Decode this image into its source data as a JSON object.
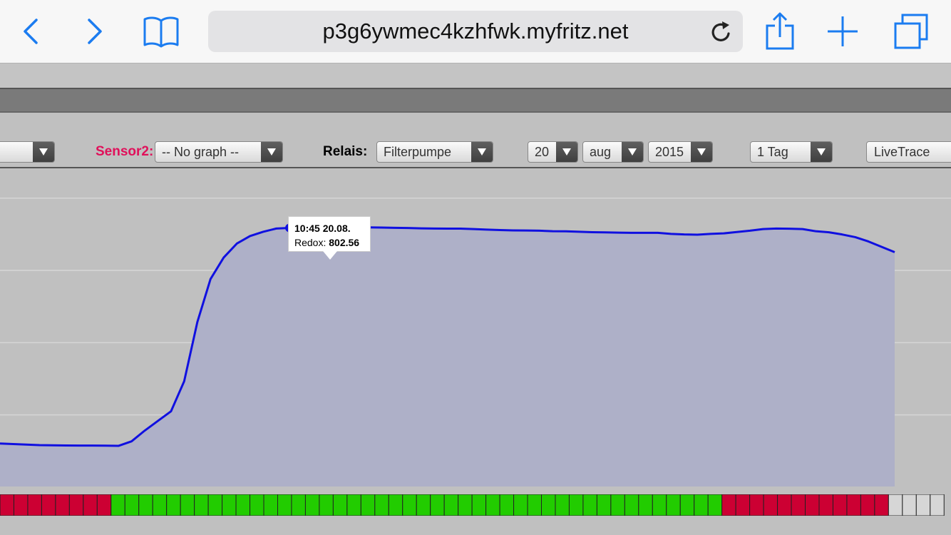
{
  "browser": {
    "url": "p3g6ywmec4kzhfwk.myfritz.net",
    "icons": [
      "back-icon",
      "forward-icon",
      "bookmarks-icon",
      "reload-icon",
      "share-icon",
      "new-tab-icon",
      "tabs-icon"
    ],
    "accent": "#1b7cf0"
  },
  "controls": {
    "sensor2_label": "Sensor2:",
    "sensor2_color": "#e0105a",
    "sensor2_value": "-- No graph --",
    "relais_label": "Relais:",
    "relais_value": "Filterpumpe",
    "day_value": "20",
    "month_value": "aug",
    "year_value": "2015",
    "range_value": "1 Tag",
    "livetrace_label": "LiveTrace"
  },
  "tooltip": {
    "time": "10:45 20.08.",
    "series_label": "Redox:",
    "value": "802.56"
  },
  "chart_data": {
    "type": "area",
    "series": [
      {
        "name": "Redox",
        "color": "#1010e0",
        "points": [
          {
            "x": 0,
            "y": 602
          },
          {
            "x": 1,
            "y": 601.5
          },
          {
            "x": 2,
            "y": 601
          },
          {
            "x": 3,
            "y": 600.5
          },
          {
            "x": 4,
            "y": 600.3
          },
          {
            "x": 5,
            "y": 600.2
          },
          {
            "x": 6,
            "y": 600.1
          },
          {
            "x": 7,
            "y": 600.1
          },
          {
            "x": 8,
            "y": 600
          },
          {
            "x": 9,
            "y": 599.8
          },
          {
            "x": 10,
            "y": 604
          },
          {
            "x": 11,
            "y": 614
          },
          {
            "x": 12,
            "y": 623
          },
          {
            "x": 13,
            "y": 632
          },
          {
            "x": 14,
            "y": 660
          },
          {
            "x": 15,
            "y": 715
          },
          {
            "x": 16,
            "y": 755
          },
          {
            "x": 17,
            "y": 775
          },
          {
            "x": 18,
            "y": 788
          },
          {
            "x": 19,
            "y": 795
          },
          {
            "x": 20,
            "y": 799
          },
          {
            "x": 21,
            "y": 802
          },
          {
            "x": 22,
            "y": 802.56
          },
          {
            "x": 23,
            "y": 803
          },
          {
            "x": 24,
            "y": 803.4
          },
          {
            "x": 25,
            "y": 803.4
          },
          {
            "x": 26,
            "y": 803.2
          },
          {
            "x": 27,
            "y": 803.2
          },
          {
            "x": 28,
            "y": 803.1
          },
          {
            "x": 29,
            "y": 802.9
          },
          {
            "x": 30,
            "y": 802.7
          },
          {
            "x": 31,
            "y": 802.5
          },
          {
            "x": 32,
            "y": 802.2
          },
          {
            "x": 33,
            "y": 802
          },
          {
            "x": 34,
            "y": 801.9
          },
          {
            "x": 35,
            "y": 801.9
          },
          {
            "x": 36,
            "y": 801.5
          },
          {
            "x": 37,
            "y": 801
          },
          {
            "x": 38,
            "y": 800.6
          },
          {
            "x": 39,
            "y": 800.3
          },
          {
            "x": 40,
            "y": 800.2
          },
          {
            "x": 41,
            "y": 800
          },
          {
            "x": 42,
            "y": 799.5
          },
          {
            "x": 43,
            "y": 799.4
          },
          {
            "x": 44,
            "y": 799
          },
          {
            "x": 45,
            "y": 798.6
          },
          {
            "x": 46,
            "y": 798.4
          },
          {
            "x": 47,
            "y": 798.2
          },
          {
            "x": 48,
            "y": 798
          },
          {
            "x": 49,
            "y": 798
          },
          {
            "x": 50,
            "y": 798
          },
          {
            "x": 51,
            "y": 797
          },
          {
            "x": 52,
            "y": 796.5
          },
          {
            "x": 53,
            "y": 796.3
          },
          {
            "x": 54,
            "y": 797
          },
          {
            "x": 55,
            "y": 797.5
          },
          {
            "x": 56,
            "y": 798.8
          },
          {
            "x": 57,
            "y": 800
          },
          {
            "x": 58,
            "y": 801.5
          },
          {
            "x": 59,
            "y": 802
          },
          {
            "x": 60,
            "y": 801.8
          },
          {
            "x": 61,
            "y": 801.5
          },
          {
            "x": 62,
            "y": 799.5
          },
          {
            "x": 63,
            "y": 798.5
          },
          {
            "x": 64,
            "y": 796.5
          },
          {
            "x": 65,
            "y": 794
          },
          {
            "x": 66,
            "y": 790
          },
          {
            "x": 67,
            "y": 785
          },
          {
            "x": 68,
            "y": 780
          }
        ]
      }
    ],
    "highlight_index": 22,
    "ylim": [
      562,
      858
    ],
    "grid": true,
    "relay_states": [
      "on",
      "on",
      "on",
      "on",
      "on",
      "on",
      "on",
      "on",
      "off",
      "off",
      "off",
      "off",
      "off",
      "off",
      "off",
      "off",
      "off",
      "off",
      "off",
      "off",
      "off",
      "off",
      "off",
      "off",
      "off",
      "off",
      "off",
      "off",
      "off",
      "off",
      "off",
      "off",
      "off",
      "off",
      "off",
      "off",
      "off",
      "off",
      "off",
      "off",
      "off",
      "off",
      "off",
      "off",
      "off",
      "off",
      "off",
      "off",
      "off",
      "off",
      "off",
      "off",
      "on",
      "on",
      "on",
      "on",
      "on",
      "on",
      "on",
      "on",
      "on",
      "on",
      "on",
      "on",
      "none",
      "none",
      "none",
      "none"
    ],
    "relay_colors": {
      "on": "#cc0033",
      "off": "#22cc00",
      "none": "#d6d6d6"
    }
  }
}
